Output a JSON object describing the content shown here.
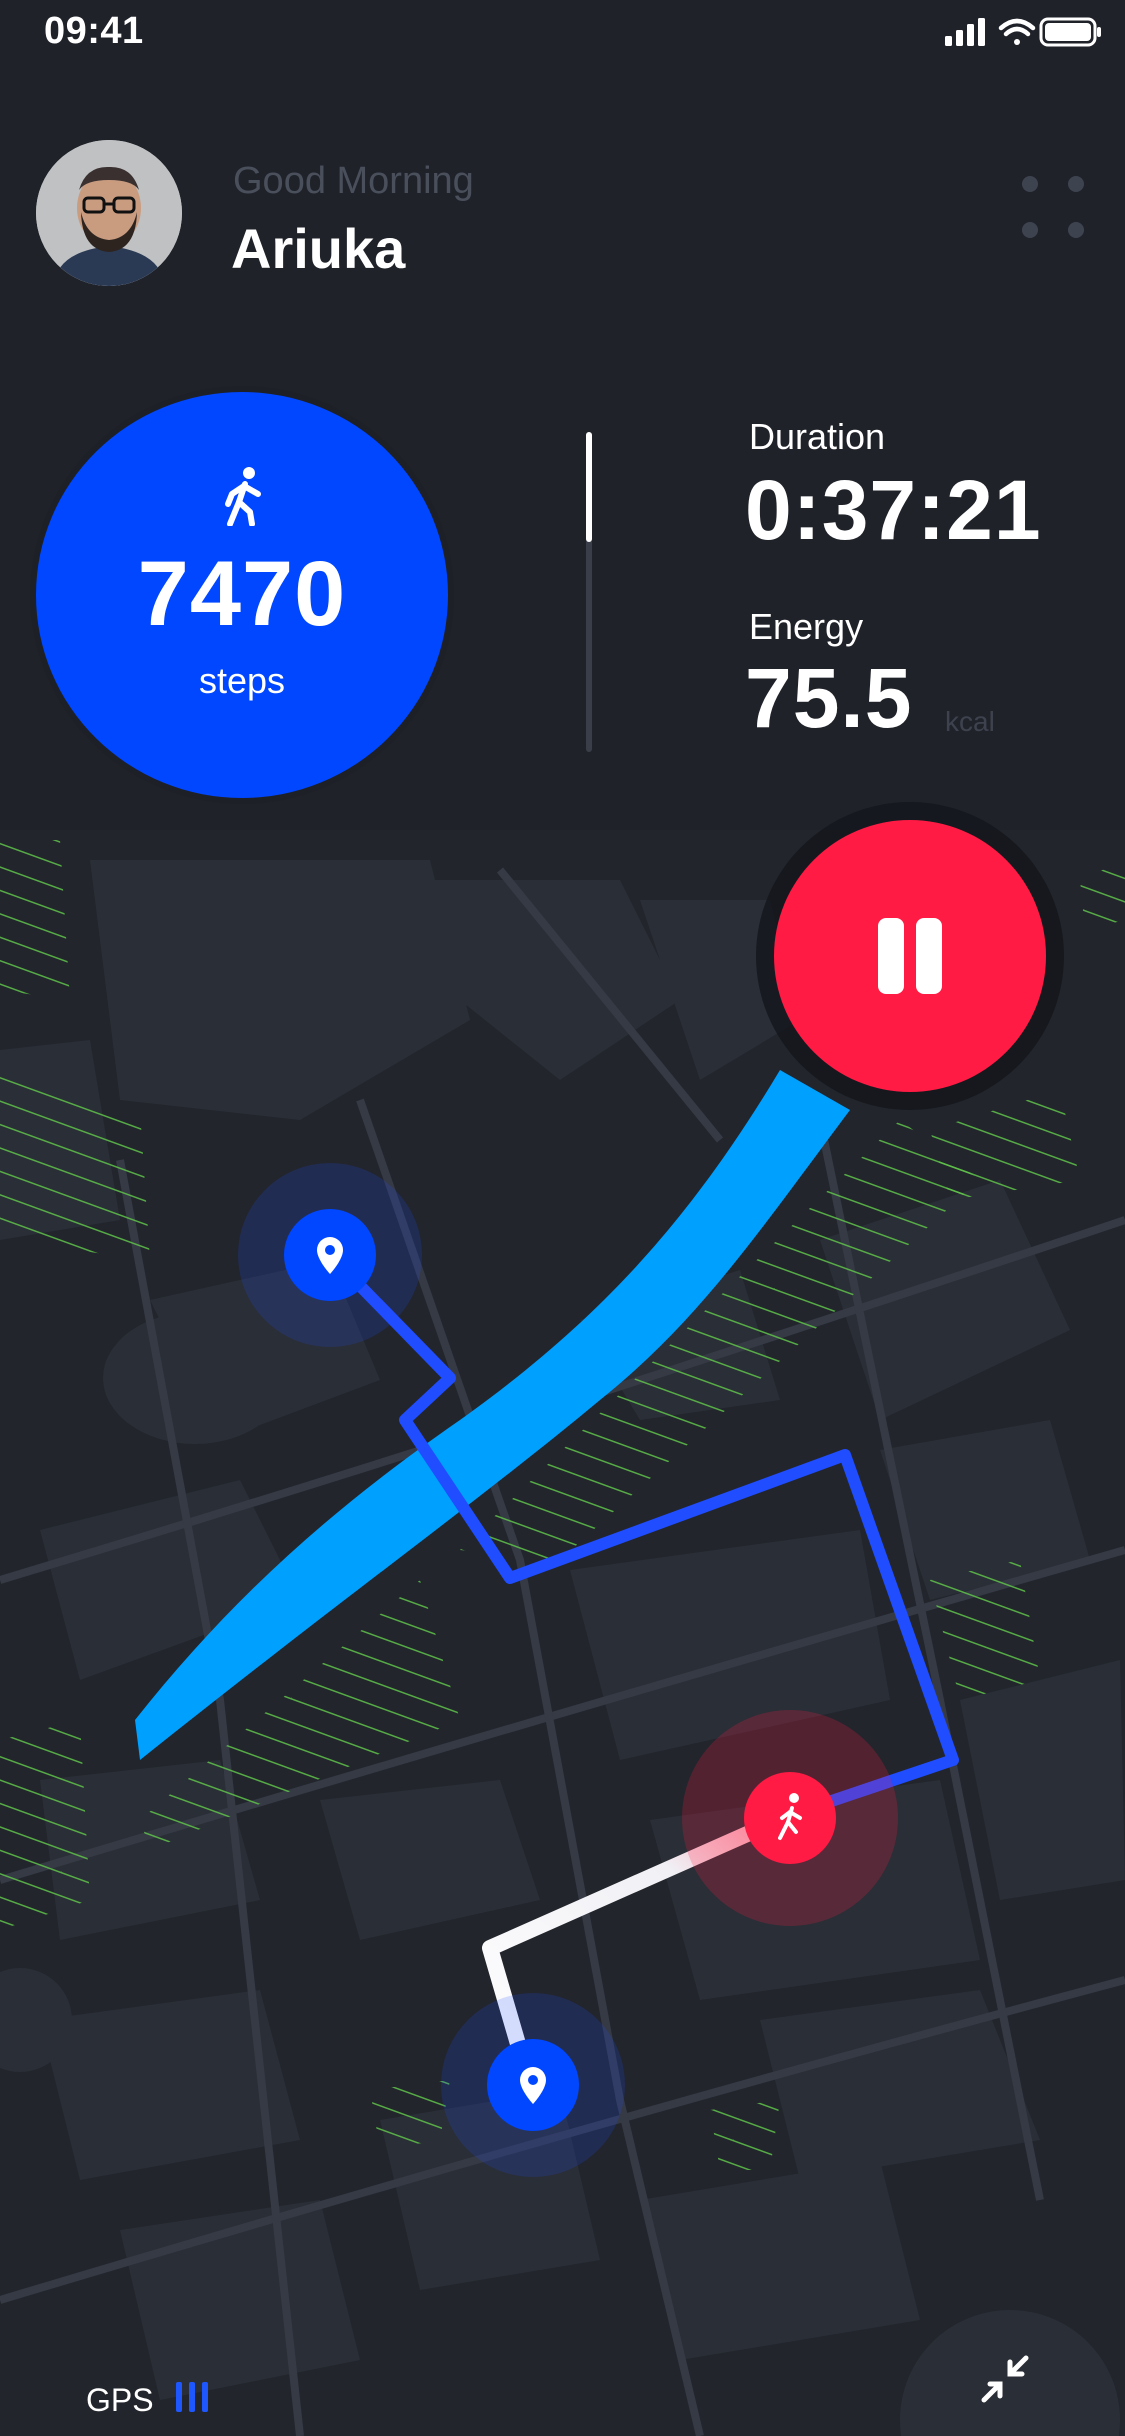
{
  "status_bar": {
    "time": "09:41",
    "icons": [
      "signal-icon",
      "wifi-icon",
      "battery-icon"
    ]
  },
  "header": {
    "greeting": "Good Morning",
    "username": "Ariuka",
    "avatar_icon": "avatar",
    "menu_icon": "grid-dots-icon"
  },
  "steps": {
    "icon": "walking-icon",
    "value": "7470",
    "unit": "steps"
  },
  "stats": {
    "duration_label": "Duration",
    "duration_value": "0:37:21",
    "energy_label": "Energy",
    "energy_value": "75.5",
    "energy_unit": "kcal"
  },
  "controls": {
    "pause_icon": "pause-icon",
    "collapse_icon": "collapse-icon"
  },
  "footer": {
    "gps_label": "GPS",
    "gps_signal_bars": 3
  },
  "colors": {
    "background": "#1f2229",
    "accent_blue": "#0047ff",
    "route_blue": "#1f4dff",
    "river_blue": "#00a0ff",
    "pause_red": "#ff1b44",
    "park_green": "#5fc24a"
  }
}
